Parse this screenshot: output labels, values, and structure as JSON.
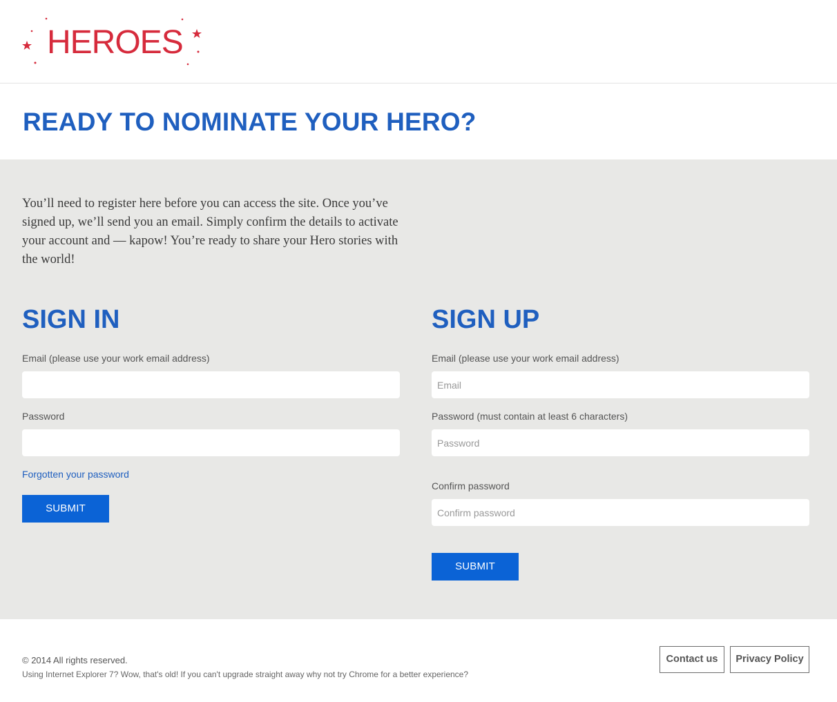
{
  "header": {
    "logo_text": "HEROES",
    "brand_color": "#d62b3c"
  },
  "page_title": "READY TO NOMINATE YOUR HERO?",
  "intro_text": "You’ll need to register here before you can access the site. Once you’ve signed up, we’ll send you an email. Simply confirm the details to activate your account and — kapow! You’re ready to share your Hero stories with the world!",
  "sign_in": {
    "title": "SIGN IN",
    "email_label": "Email (please use your work email address)",
    "email_value": "",
    "password_label": "Password",
    "password_value": "",
    "forgot_link": "Forgotten your password",
    "submit_label": "SUBMIT"
  },
  "sign_up": {
    "title": "SIGN UP",
    "email_label": "Email (please use your work email address)",
    "email_placeholder": "Email",
    "password_label": "Password (must contain at least 6 characters)",
    "password_placeholder": "Password",
    "confirm_label": "Confirm password",
    "confirm_placeholder": "Confirm password",
    "submit_label": "SUBMIT"
  },
  "footer": {
    "copyright": "© 2014 All rights reserved.",
    "browser_note": "Using Internet Explorer 7? Wow, that's old! If you can't upgrade straight away why not try Chrome for a better experience?",
    "contact_label": "Contact us",
    "privacy_label": "Privacy Policy"
  },
  "colors": {
    "accent": "#1f5fbf",
    "button": "#0b63d6",
    "panel_bg": "#e8e8e6"
  },
  "icons": {
    "logo_decoration": "star-icon"
  }
}
